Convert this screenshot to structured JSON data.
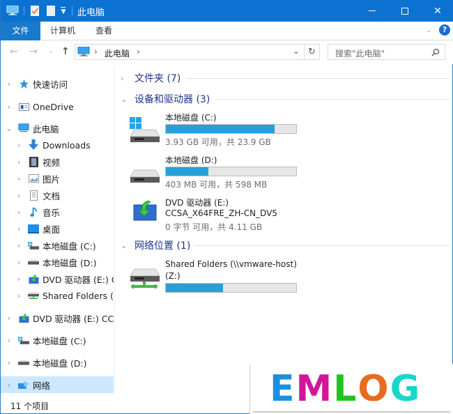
{
  "window": {
    "title": "此电脑",
    "controls": {
      "minimize": "—",
      "maximize": "☐",
      "close": "✕"
    }
  },
  "quick_access_toolbar": {
    "icons": [
      "pc-icon",
      "properties-icon",
      "new-folder-icon",
      "customize-dropdown-icon"
    ]
  },
  "ribbon": {
    "tabs": [
      {
        "label": "文件",
        "active": true
      },
      {
        "label": "计算机",
        "active": false
      },
      {
        "label": "查看",
        "active": false
      }
    ],
    "expand_icon": "chevron-down-icon",
    "help_icon": "?"
  },
  "navigation": {
    "back": "←",
    "forward": "→",
    "recent": "⌄",
    "up": "↑",
    "breadcrumb": [
      "此电脑"
    ],
    "breadcrumb_sep": "›",
    "history_dropdown": "⌄",
    "refresh": "↻",
    "search_placeholder": "搜索\"此电脑\"",
    "search_icon": "⚲"
  },
  "sidebar": {
    "items": [
      {
        "label": "快速访问",
        "icon": "star-icon",
        "level": 0,
        "expanded": false
      },
      {
        "label": "OneDrive",
        "icon": "onedrive-icon",
        "level": 0,
        "expanded": false
      },
      {
        "label": "此电脑",
        "icon": "pc-icon",
        "level": 0,
        "expanded": true
      },
      {
        "label": "Downloads",
        "icon": "download-icon",
        "level": 1,
        "expanded": false
      },
      {
        "label": "视频",
        "icon": "video-icon",
        "level": 1,
        "expanded": false
      },
      {
        "label": "图片",
        "icon": "pictures-icon",
        "level": 1,
        "expanded": false
      },
      {
        "label": "文档",
        "icon": "documents-icon",
        "level": 1,
        "expanded": false
      },
      {
        "label": "音乐",
        "icon": "music-icon",
        "level": 1,
        "expanded": false
      },
      {
        "label": "桌面",
        "icon": "desktop-icon",
        "level": 1,
        "expanded": false
      },
      {
        "label": "本地磁盘 (C:)",
        "icon": "system-drive-icon",
        "level": 1,
        "expanded": false
      },
      {
        "label": "本地磁盘 (D:)",
        "icon": "drive-icon",
        "level": 1,
        "expanded": false
      },
      {
        "label": "DVD 驱动器 (E:) CC",
        "icon": "dvd-icon",
        "level": 1,
        "expanded": false
      },
      {
        "label": "Shared Folders (\\\\",
        "icon": "network-drive-icon",
        "level": 1,
        "expanded": false
      },
      {
        "label": "DVD 驱动器 (E:) CCS",
        "icon": "dvd-icon",
        "level": 0,
        "expanded": false
      },
      {
        "label": "本地磁盘 (C:)",
        "icon": "system-drive-icon",
        "level": 0,
        "expanded": false
      },
      {
        "label": "本地磁盘 (D:)",
        "icon": "drive-icon",
        "level": 0,
        "expanded": false
      },
      {
        "label": "网络",
        "icon": "network-icon",
        "level": 0,
        "expanded": false,
        "selected": true
      }
    ]
  },
  "content": {
    "groups": [
      {
        "title": "文件夹 (7)",
        "expanded": false
      },
      {
        "title": "设备和驱动器 (3)",
        "expanded": true
      },
      {
        "title": "网络位置 (1)",
        "expanded": true
      }
    ],
    "drives": [
      {
        "name": "本地磁盘 (C:)",
        "icon": "system-drive-icon",
        "info": "3.93 GB 可用，共 23.9 GB",
        "used_fraction": 0.836
      },
      {
        "name": "本地磁盘 (D:)",
        "icon": "drive-icon",
        "info": "403 MB 可用，共 598 MB",
        "used_fraction": 0.326
      },
      {
        "name": "DVD 驱动器 (E:)",
        "name2": "CCSA_X64FRE_ZH-CN_DV5",
        "icon": "dvd-icon",
        "info": "0 字节 可用，共 4.11 GB"
      }
    ],
    "network": [
      {
        "name": "Shared Folders (\\\\vmware-host)",
        "name2": "(Z:)",
        "icon": "network-drive-icon",
        "used_fraction": 0.44
      }
    ]
  },
  "status": {
    "item_count": "11 个项目"
  },
  "watermark": {
    "letters": [
      {
        "char": "E",
        "color": "#1b8fe0"
      },
      {
        "char": "M",
        "color": "#d4159c"
      },
      {
        "char": "L",
        "color": "#1ec41e"
      },
      {
        "char": "O",
        "color": "#ea6a22"
      },
      {
        "char": "G",
        "color": "#1ad6c8"
      }
    ]
  },
  "colors": {
    "titlebar": "#0c72d2",
    "file_tab": "#1979ca",
    "selection": "#cce8ff",
    "progress": "#26a0da",
    "group_heading": "#1e3287"
  }
}
